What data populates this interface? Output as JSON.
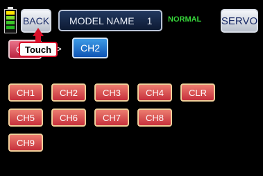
{
  "header": {
    "back_label": "BACK",
    "model_name_label": "MODEL NAME",
    "model_number": "1",
    "mode": "NORMAL",
    "servo_label": "SERVO"
  },
  "battery": {
    "icon": "battery-icon",
    "colors": [
      "#ffe400",
      "#7ddc2a",
      "#3bc728",
      "#22b61f"
    ]
  },
  "assignment": {
    "source_label": "CH1",
    "arrow": "->",
    "target_label": "CH2"
  },
  "channels": [
    "CH1",
    "CH2",
    "CH3",
    "CH4",
    "CLR",
    "CH5",
    "CH6",
    "CH7",
    "CH8",
    "CH9"
  ],
  "callout": {
    "label": "Touch",
    "color": "#d9102a"
  },
  "colors": {
    "mode_text": "#36d43a",
    "channel_button": "#c7303c",
    "target_button": "#0f55b5"
  }
}
